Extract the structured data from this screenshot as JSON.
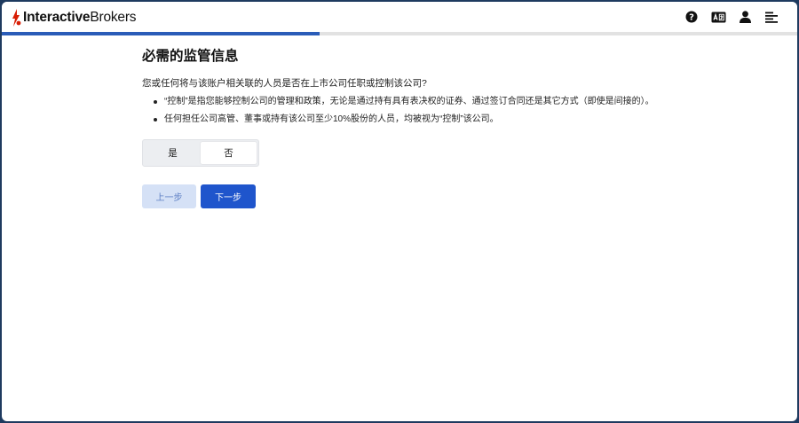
{
  "brand": {
    "name_bold": "Interactive",
    "name_regular": "Brokers",
    "logo_color": "#d81e05"
  },
  "topbar": {
    "icons": [
      "help-icon",
      "language-icon",
      "user-icon",
      "menu-icon"
    ]
  },
  "progress": {
    "fraction": 0.4
  },
  "page": {
    "title": "必需的监管信息",
    "question": "您或任何将与该账户相关联的人员是否在上市公司任职或控制该公司?",
    "bullets": [
      "“控制”是指您能够控制公司的管理和政策，无论是通过持有具有表决权的证券、通过签订合同还是其它方式（即使是间接的）。",
      "任何担任公司高管、董事或持有该公司至少10%股份的人员，均被视为“控制”该公司。"
    ],
    "options": {
      "yes": "是",
      "no": "否",
      "selected": "no"
    },
    "back_label": "上一步",
    "next_label": "下一步"
  },
  "colors": {
    "accent": "#1f55cc",
    "progress": "#2a5cb8",
    "back_bg": "#d5e1f6"
  }
}
